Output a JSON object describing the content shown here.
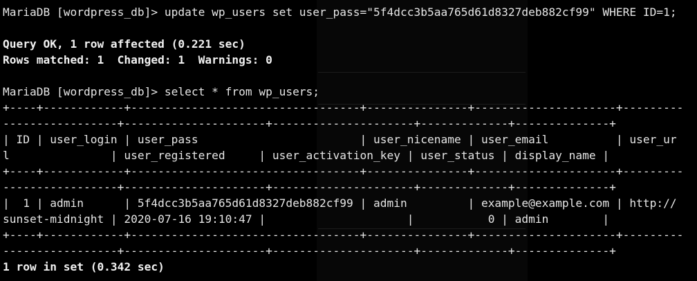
{
  "terminal": {
    "background": "#000000",
    "foreground": "#e6e6e6",
    "lines": [
      {
        "text": "MariaDB [wordpress_db]> update wp_users set user_pass=\"5f4dcc3b5aa765d61d8327deb882cf99\" WHERE ID=1;",
        "bold": false
      },
      {
        "text": "",
        "bold": false
      },
      {
        "text": "Query OK, 1 row affected (0.221 sec)",
        "bold": true
      },
      {
        "text": "Rows matched: 1  Changed: 1  Warnings: 0",
        "bold": true
      },
      {
        "text": "",
        "bold": false
      },
      {
        "text": "MariaDB [wordpress_db]> select * from wp_users;",
        "bold": false
      },
      {
        "text": "+----+------------+----------------------------------+---------------+---------------------+---------",
        "bold": false
      },
      {
        "text": "-----------------+---------------------+---------------------+-------------+--------------+",
        "bold": false
      },
      {
        "text": "| ID | user_login | user_pass                        | user_nicename | user_email          | user_ur",
        "bold": false
      },
      {
        "text": "l               | user_registered     | user_activation_key | user_status | display_name |",
        "bold": false
      },
      {
        "text": "+----+------------+----------------------------------+---------------+---------------------+---------",
        "bold": false
      },
      {
        "text": "-----------------+---------------------+---------------------+-------------+--------------+",
        "bold": false
      },
      {
        "text": "|  1 | admin      | 5f4dcc3b5aa765d61d8327deb882cf99 | admin         | example@example.com | http://",
        "bold": false
      },
      {
        "text": "sunset-midnight | 2020-07-16 19:10:47 |                     |           0 | admin        |",
        "bold": false
      },
      {
        "text": "+----+------------+----------------------------------+---------------+---------------------+---------",
        "bold": false
      },
      {
        "text": "-----------------+---------------------+---------------------+-------------+--------------+",
        "bold": false
      },
      {
        "text": "1 row in set (0.342 sec)",
        "bold": true
      }
    ]
  }
}
